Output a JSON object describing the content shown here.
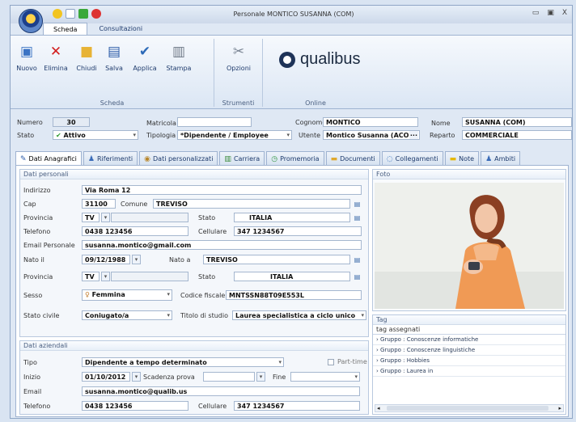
{
  "window": {
    "title": "Personale MONTICO SUSANNA (COM)",
    "min_label": "▭",
    "max_label": "▣",
    "close_label": "X"
  },
  "ribbon_tabs": [
    "Scheda",
    "Consultazioni"
  ],
  "ribbon": {
    "groups": {
      "scheda": "Scheda",
      "strumenti": "Strumenti",
      "online": "Online"
    },
    "buttons": {
      "nuovo": "Nuovo",
      "elimina": "Elimina",
      "chiudi": "Chiudi",
      "salva": "Salva",
      "applica": "Applica",
      "stampa": "Stampa",
      "opzioni": "Opzioni"
    },
    "logo": "qualibus"
  },
  "header": {
    "numero_label": "Numero",
    "numero": "30",
    "matricola_label": "Matricola",
    "matricola": "",
    "cognome_label": "Cognome",
    "cognome": "MONTICO",
    "nome_label": "Nome",
    "nome": "SUSANNA (COM)",
    "stato_label": "Stato",
    "stato": "Attivo",
    "tipologia_label": "Tipologia",
    "tipologia": "*Dipendente / Employee",
    "utente_label": "Utente",
    "utente": "Montico Susanna (ACOM",
    "utente_more": "···",
    "reparto_label": "Reparto",
    "reparto": "COMMERCIALE"
  },
  "tabs": [
    "Dati Anagrafici",
    "Riferimenti",
    "Dati personalizzati",
    "Carriera",
    "Promemoria",
    "Documenti",
    "Collegamenti",
    "Note",
    "Ambiti"
  ],
  "dati_personali": {
    "title": "Dati personali",
    "indirizzo_label": "Indirizzo",
    "indirizzo": "Via Roma 12",
    "cap_label": "Cap",
    "cap": "31100",
    "comune_label": "Comune",
    "comune": "TREVISO",
    "provincia_label": "Provincia",
    "provincia": "TV",
    "stato_label": "Stato",
    "stato": "ITALIA",
    "telefono_label": "Telefono",
    "telefono": "0438 123456",
    "cellulare_label": "Cellulare",
    "cellulare": "347 1234567",
    "email_label": "Email Personale",
    "email": "susanna.montico@gmail.com",
    "nato_il_label": "Nato il",
    "nato_il": "09/12/1988",
    "nato_a_label": "Nato a",
    "nato_a": "TREVISO",
    "provincia2": "TV",
    "stato2": "ITALIA",
    "sesso_label": "Sesso",
    "sesso": "Femmina",
    "cf_label": "Codice fiscale",
    "cf": "MNTSSN88T09E553L",
    "stato_civile_label": "Stato civile",
    "stato_civile": "Coniugato/a",
    "titolo_label": "Titolo di studio",
    "titolo": "Laurea specialistica a ciclo unico"
  },
  "dati_aziendali": {
    "title": "Dati aziendali",
    "tipo_label": "Tipo",
    "tipo": "Dipendente a tempo determinato",
    "parttime_label": "Part-time",
    "inizio_label": "Inizio",
    "inizio": "01/10/2012",
    "scadenza_label": "Scadenza prova",
    "scadenza": "",
    "fine_label": "Fine",
    "fine": "",
    "email_label": "Email",
    "email": "susanna.montico@qualib.us",
    "telefono_label": "Telefono",
    "telefono": "0438 123456",
    "cellulare_label": "Cellulare",
    "cellulare": "347 1234567"
  },
  "foto": {
    "title": "Foto"
  },
  "tag": {
    "title": "Tag",
    "header": "tag assegnati",
    "items": [
      "Gruppo : Conoscenze informatiche",
      "Gruppo : Conoscenze linguistiche",
      "Gruppo : Hobbies",
      "Gruppo : Laurea in"
    ]
  }
}
